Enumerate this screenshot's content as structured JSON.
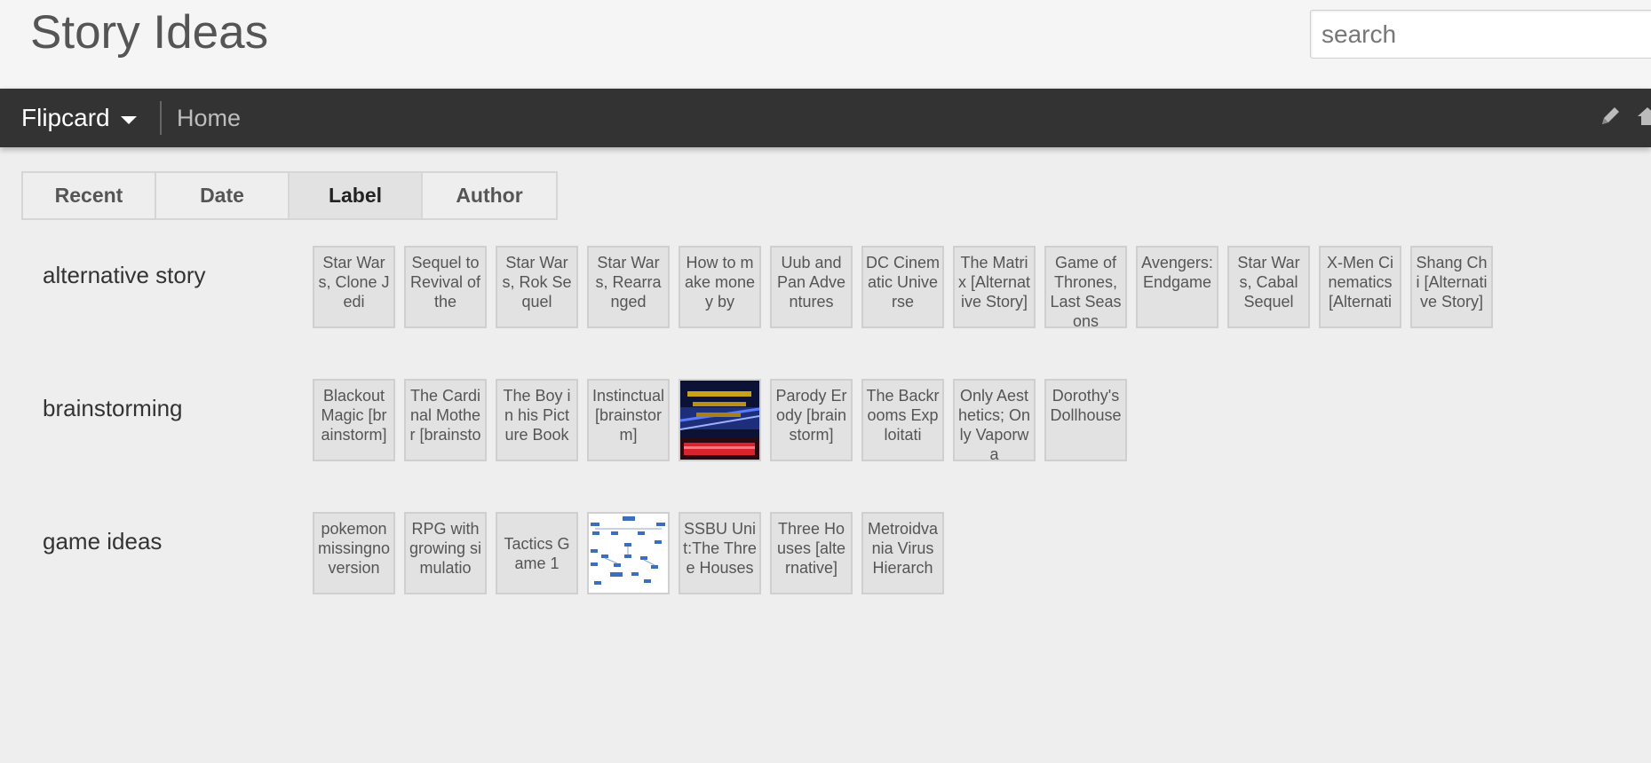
{
  "header": {
    "title": "Story Ideas",
    "search_placeholder": "search"
  },
  "navbar": {
    "view_label": "Flipcard",
    "home_label": "Home",
    "icons": [
      "pencil-icon",
      "home-icon"
    ]
  },
  "tabs": [
    {
      "label": "Recent",
      "active": false
    },
    {
      "label": "Date",
      "active": false
    },
    {
      "label": "Label",
      "active": true
    },
    {
      "label": "Author",
      "active": false
    }
  ],
  "groups": [
    {
      "label": "alternative story",
      "cards": [
        {
          "text": "Star Wars, Clone Jedi"
        },
        {
          "text": "Sequel to Revival of the"
        },
        {
          "text": "Star Wars, Rok Sequel"
        },
        {
          "text": "Star Wars, Rearranged"
        },
        {
          "text": "How to make money by"
        },
        {
          "text": "Uub and Pan Adventures"
        },
        {
          "text": "DC Cinematic Universe"
        },
        {
          "text": "The Matrix [Alternative Story]"
        },
        {
          "text": "Game of Thrones, Last Seasons"
        },
        {
          "text": "Avengers: Endgame"
        },
        {
          "text": "Star Wars, Cabal Sequel"
        },
        {
          "text": "X-Men Cinematics [Alternati"
        },
        {
          "text": "Shang Chi [Alternative Story]"
        }
      ]
    },
    {
      "label": "brainstorming",
      "cards": [
        {
          "text": "Blackout Magic [brainstorm]"
        },
        {
          "text": "The Cardinal Mother [brainsto"
        },
        {
          "text": "The Boy in his Picture Book"
        },
        {
          "text": "Instinctual [brainstorm]"
        },
        {
          "text": "",
          "image": "neon-error-thumbnail"
        },
        {
          "text": "Parody Erody [brainstorm]"
        },
        {
          "text": "The Backrooms Exploitati"
        },
        {
          "text": "Only Aesthetics; Only Vaporwa"
        },
        {
          "text": "Dorothy's Dollhouse"
        }
      ]
    },
    {
      "label": "game ideas",
      "cards": [
        {
          "text": "pokemon missingno version"
        },
        {
          "text": "RPG with growing simulatio"
        },
        {
          "text": "Tactics Game 1"
        },
        {
          "text": "",
          "image": "flowchart-thumbnail"
        },
        {
          "text": "SSBU Unit:The Three Houses"
        },
        {
          "text": "Three Houses [alternative]"
        },
        {
          "text": "Metroidvania Virus Hierarch"
        }
      ]
    }
  ]
}
